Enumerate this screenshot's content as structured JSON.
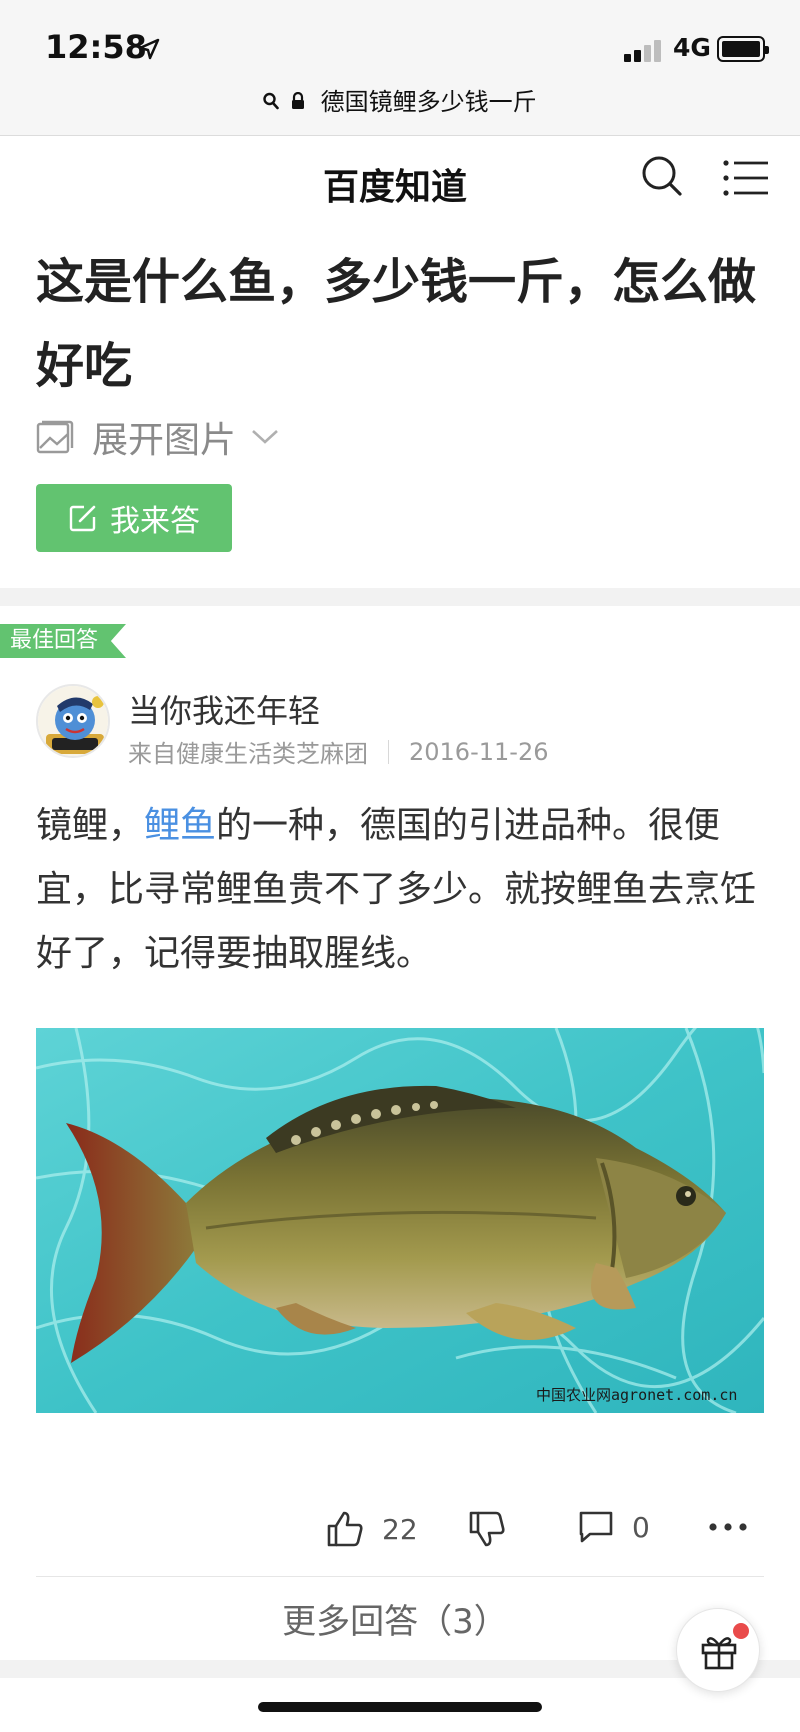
{
  "status_bar": {
    "time": "12:58",
    "network": "4G"
  },
  "address_bar": {
    "url_text": "德国镜鲤多少钱一斤"
  },
  "header": {
    "brand": "百度知道"
  },
  "question": {
    "title": "这是什么鱼，多少钱一斤，怎么做好吃",
    "expand_images_label": "展开图片",
    "answer_button_label": "我来答"
  },
  "best_answer": {
    "tag": "最佳回答",
    "user_name": "当你我还年轻",
    "source": "来自健康生活类芝麻团",
    "date": "2016-11-26",
    "text_before_link": "镜鲤，",
    "link_text": "鲤鱼",
    "text_after_link": "的一种，德国的引进品种。很便宜，比寻常鲤鱼贵不了多少。就按鲤鱼去烹饪好了，记得要抽取腥线。",
    "image_watermark": "中国农业网agronet.com.cn",
    "like_count": "22",
    "comment_count": "0",
    "more_answers_label": "更多回答（3）"
  },
  "colors": {
    "accent_green": "#62c370",
    "link_blue": "#4a90e2",
    "badge_red": "#e94b4b"
  },
  "icons": [
    "location-arrow-icon",
    "lock-icon",
    "search-icon",
    "menu-icon",
    "image-icon",
    "chevron-down-icon",
    "edit-icon",
    "thumb-up-icon",
    "thumb-down-icon",
    "comment-icon",
    "more-icon",
    "gift-icon"
  ]
}
